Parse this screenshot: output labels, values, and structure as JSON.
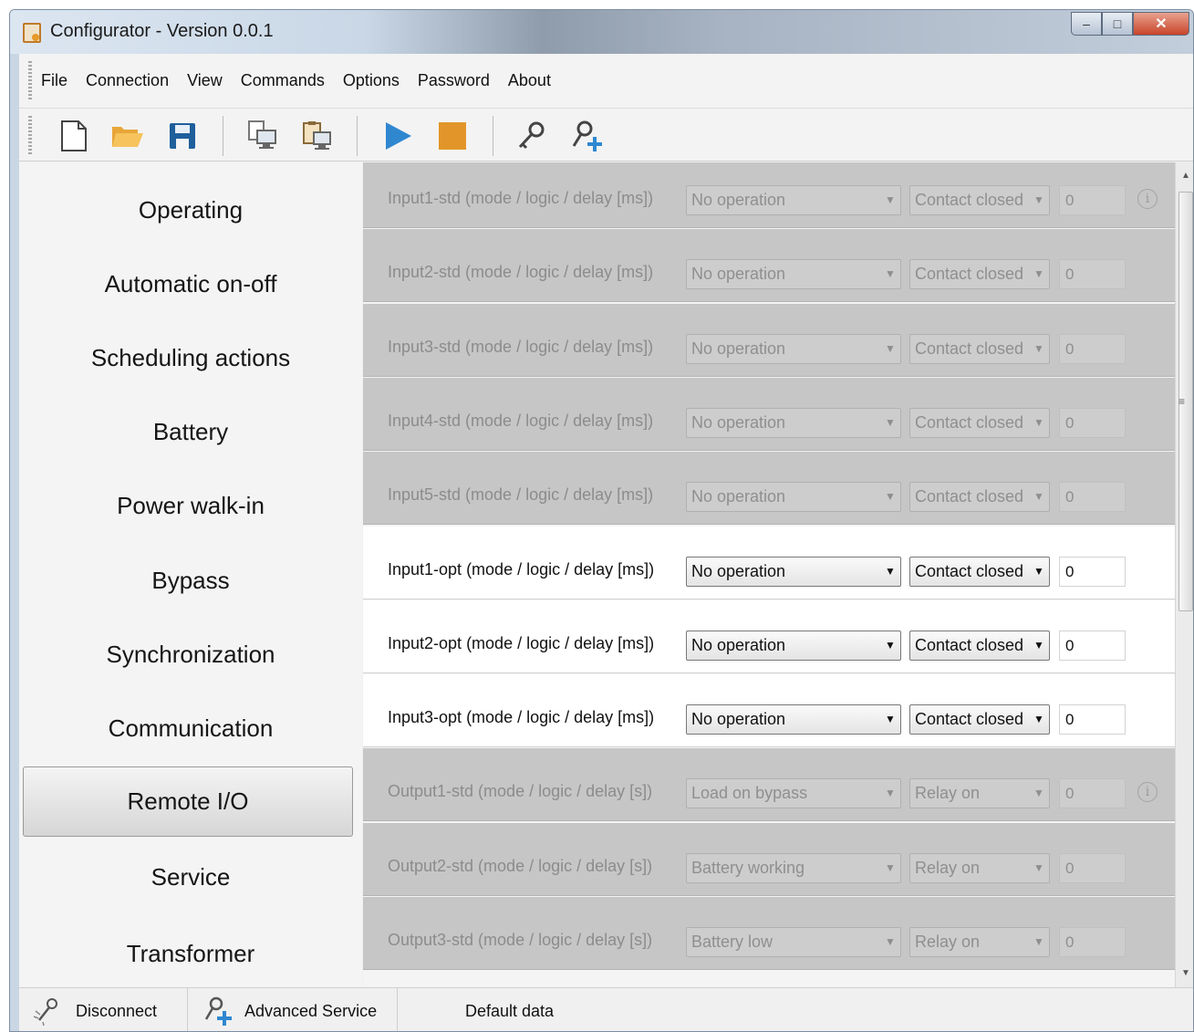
{
  "window": {
    "title": "Configurator - Version 0.0.1"
  },
  "menu": [
    "File",
    "Connection",
    "View",
    "Commands",
    "Options",
    "Password",
    "About"
  ],
  "toolbar": {
    "icons": [
      "new-file-icon",
      "open-folder-icon",
      "save-icon",
      "copy-to-device-icon",
      "paste-from-device-icon",
      "play-icon",
      "stop-icon",
      "key-icon",
      "add-user-icon"
    ],
    "colors": {
      "play": "#2f87d0",
      "stop": "#e2962a",
      "folder": "#f0b247",
      "save": "#1f5f9c"
    }
  },
  "nav": {
    "items": [
      "Operating",
      "Automatic on-off",
      "Scheduling actions",
      "Battery",
      "Power walk-in",
      "Bypass",
      "Synchronization",
      "Communication",
      "Remote I/O",
      "Service",
      "Transformer"
    ],
    "selected": "Remote I/O"
  },
  "rows": [
    {
      "label": "Input1-std (mode / logic / delay [ms])",
      "mode": "No operation",
      "logic": "Contact closed",
      "delay": "0",
      "enabled": false,
      "info": true
    },
    {
      "label": "Input2-std (mode / logic / delay [ms])",
      "mode": "No operation",
      "logic": "Contact closed",
      "delay": "0",
      "enabled": false,
      "info": false
    },
    {
      "label": "Input3-std (mode / logic / delay [ms])",
      "mode": "No operation",
      "logic": "Contact closed",
      "delay": "0",
      "enabled": false,
      "info": false
    },
    {
      "label": "Input4-std (mode / logic / delay [ms])",
      "mode": "No operation",
      "logic": "Contact closed",
      "delay": "0",
      "enabled": false,
      "info": false
    },
    {
      "label": "Input5-std (mode / logic / delay [ms])",
      "mode": "No operation",
      "logic": "Contact closed",
      "delay": "0",
      "enabled": false,
      "info": false
    },
    {
      "label": "Input1-opt (mode / logic / delay [ms])",
      "mode": "No operation",
      "logic": "Contact closed",
      "delay": "0",
      "enabled": true,
      "info": false
    },
    {
      "label": "Input2-opt (mode / logic / delay [ms])",
      "mode": "No operation",
      "logic": "Contact closed",
      "delay": "0",
      "enabled": true,
      "info": false
    },
    {
      "label": "Input3-opt (mode / logic / delay [ms])",
      "mode": "No operation",
      "logic": "Contact closed",
      "delay": "0",
      "enabled": true,
      "info": false
    },
    {
      "label": "Output1-std (mode / logic / delay [s])",
      "mode": "Load on bypass",
      "logic": "Relay on",
      "delay": "0",
      "enabled": false,
      "info": true
    },
    {
      "label": "Output2-std (mode / logic / delay [s])",
      "mode": "Battery working",
      "logic": "Relay on",
      "delay": "0",
      "enabled": false,
      "info": false
    },
    {
      "label": "Output3-std (mode / logic / delay [s])",
      "mode": "Battery low",
      "logic": "Relay on",
      "delay": "0",
      "enabled": false,
      "info": false
    }
  ],
  "status": {
    "disconnect": "Disconnect",
    "advanced": "Advanced Service",
    "data": "Default data"
  }
}
